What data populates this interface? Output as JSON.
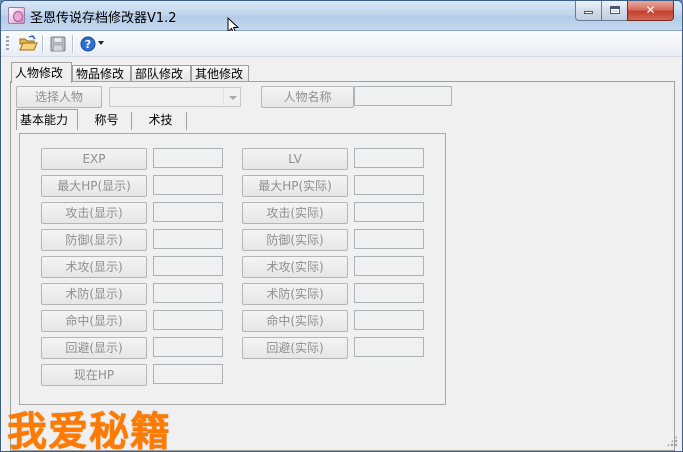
{
  "window": {
    "title": "圣恩传说存档修改器V1.2",
    "controls": {
      "minimize": "",
      "maximize": "",
      "close": "✕"
    }
  },
  "toolbar": {
    "open_icon": "folder-open-icon",
    "save_icon": "save-icon",
    "help_icon": "help-icon"
  },
  "main_tabs": [
    "人物修改",
    "物品修改",
    "部队修改",
    "其他修改"
  ],
  "character": {
    "select_button": "选择人物",
    "select_value": "",
    "name_button": "人物名称",
    "name_value": ""
  },
  "sub_tabs": [
    "基本能力",
    "称号",
    "术技"
  ],
  "stats_left": [
    {
      "label": "EXP",
      "value": ""
    },
    {
      "label": "最大HP(显示)",
      "value": ""
    },
    {
      "label": "攻击(显示)",
      "value": ""
    },
    {
      "label": "防御(显示)",
      "value": ""
    },
    {
      "label": "术攻(显示)",
      "value": ""
    },
    {
      "label": "术防(显示)",
      "value": ""
    },
    {
      "label": "命中(显示)",
      "value": ""
    },
    {
      "label": "回避(显示)",
      "value": ""
    },
    {
      "label": "现在HP",
      "value": ""
    }
  ],
  "stats_right": [
    {
      "label": "LV",
      "value": ""
    },
    {
      "label": "最大HP(实际)",
      "value": ""
    },
    {
      "label": "攻击(实际)",
      "value": ""
    },
    {
      "label": "防御(实际)",
      "value": ""
    },
    {
      "label": "术攻(实际)",
      "value": ""
    },
    {
      "label": "术防(实际)",
      "value": ""
    },
    {
      "label": "命中(实际)",
      "value": ""
    },
    {
      "label": "回避(实际)",
      "value": ""
    }
  ],
  "watermark": "我爱秘籍",
  "colors": {
    "watermark": "#ff7a00",
    "close_button": "#c1402c",
    "disabled_text": "#8f8f8f"
  }
}
